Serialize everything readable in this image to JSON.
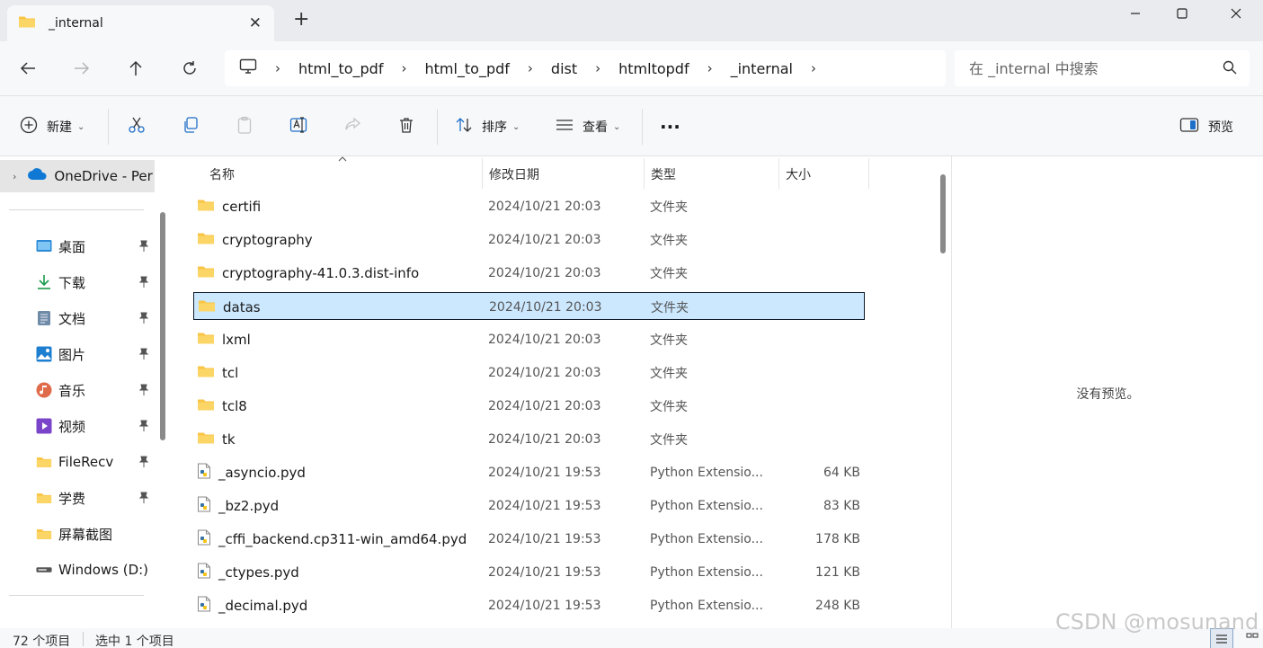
{
  "tab": {
    "title": "_internal",
    "close_label": "✕",
    "new_tab_label": "+"
  },
  "window_controls": {
    "minimize": "—",
    "maximize": "☐",
    "close": "✕"
  },
  "nav": {
    "back": "←",
    "forward": "→",
    "up": "↑",
    "refresh": "↻"
  },
  "breadcrumbs": [
    "html_to_pdf",
    "html_to_pdf",
    "dist",
    "htmltopdf",
    "_internal"
  ],
  "breadcrumb_separator": "›",
  "search": {
    "placeholder": "在 _internal 中搜索"
  },
  "commands": {
    "new_label": "新建",
    "sort_label": "排序",
    "view_label": "查看",
    "more_label": "···",
    "preview_label": "预览"
  },
  "sidebar": {
    "onedrive_label": "OneDrive - Per",
    "items": [
      {
        "label": "桌面",
        "icon": "desktop-icon",
        "pinned": true
      },
      {
        "label": "下载",
        "icon": "download-icon",
        "pinned": true
      },
      {
        "label": "文档",
        "icon": "document-icon",
        "pinned": true
      },
      {
        "label": "图片",
        "icon": "pictures-icon",
        "pinned": true
      },
      {
        "label": "音乐",
        "icon": "music-icon",
        "pinned": true
      },
      {
        "label": "视频",
        "icon": "videos-icon",
        "pinned": true
      },
      {
        "label": "FileRecv",
        "icon": "folder-icon",
        "pinned": true
      },
      {
        "label": "学费",
        "icon": "folder-icon",
        "pinned": true
      },
      {
        "label": "屏幕截图",
        "icon": "folder-icon",
        "pinned": false
      },
      {
        "label": "Windows (D:)",
        "icon": "drive-icon",
        "pinned": false
      }
    ]
  },
  "columns": {
    "name": "名称",
    "date": "修改日期",
    "type": "类型",
    "size": "大小"
  },
  "files": [
    {
      "name": "certifi",
      "date": "2024/10/21 20:03",
      "type": "文件夹",
      "size": "",
      "kind": "folder",
      "selected": false
    },
    {
      "name": "cryptography",
      "date": "2024/10/21 20:03",
      "type": "文件夹",
      "size": "",
      "kind": "folder",
      "selected": false
    },
    {
      "name": "cryptography-41.0.3.dist-info",
      "date": "2024/10/21 20:03",
      "type": "文件夹",
      "size": "",
      "kind": "folder",
      "selected": false
    },
    {
      "name": "datas",
      "date": "2024/10/21 20:03",
      "type": "文件夹",
      "size": "",
      "kind": "folder",
      "selected": true
    },
    {
      "name": "lxml",
      "date": "2024/10/21 20:03",
      "type": "文件夹",
      "size": "",
      "kind": "folder",
      "selected": false
    },
    {
      "name": "tcl",
      "date": "2024/10/21 20:03",
      "type": "文件夹",
      "size": "",
      "kind": "folder",
      "selected": false
    },
    {
      "name": "tcl8",
      "date": "2024/10/21 20:03",
      "type": "文件夹",
      "size": "",
      "kind": "folder",
      "selected": false
    },
    {
      "name": "tk",
      "date": "2024/10/21 20:03",
      "type": "文件夹",
      "size": "",
      "kind": "folder",
      "selected": false
    },
    {
      "name": "_asyncio.pyd",
      "date": "2024/10/21 19:53",
      "type": "Python Extensio...",
      "size": "64 KB",
      "kind": "pyd",
      "selected": false
    },
    {
      "name": "_bz2.pyd",
      "date": "2024/10/21 19:53",
      "type": "Python Extensio...",
      "size": "83 KB",
      "kind": "pyd",
      "selected": false
    },
    {
      "name": "_cffi_backend.cp311-win_amd64.pyd",
      "date": "2024/10/21 19:53",
      "type": "Python Extensio...",
      "size": "178 KB",
      "kind": "pyd",
      "selected": false
    },
    {
      "name": "_ctypes.pyd",
      "date": "2024/10/21 19:53",
      "type": "Python Extensio...",
      "size": "121 KB",
      "kind": "pyd",
      "selected": false
    },
    {
      "name": "_decimal.pyd",
      "date": "2024/10/21 19:53",
      "type": "Python Extensio...",
      "size": "248 KB",
      "kind": "pyd",
      "selected": false
    }
  ],
  "preview_pane": {
    "empty_text": "没有预览。"
  },
  "status": {
    "item_count": "72 个项目",
    "selection": "选中 1 个项目"
  },
  "watermark": "CSDN @mosunand",
  "colors": {
    "selection_bg": "#cce8ff",
    "folder_yellow": "#f8c546",
    "accent_blue": "#0067c0"
  }
}
